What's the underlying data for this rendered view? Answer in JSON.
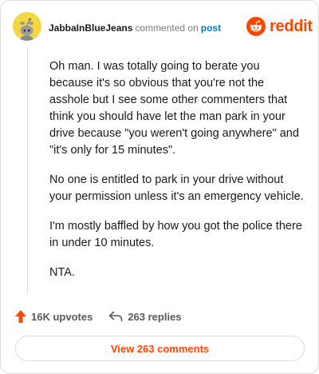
{
  "header": {
    "username": "JabbaInBlueJeans",
    "action": "commented on",
    "post_link": "post"
  },
  "brand": {
    "wordmark": "reddit",
    "icon": "reddit-snoo-icon",
    "color": "#ff4500"
  },
  "avatar": {
    "icon": "snoo-avatar-icon",
    "background": "#f3d743"
  },
  "comment": {
    "paragraphs": [
      "Oh man. I was totally going to berate you because it's so obvious that you're not the asshole but I see some other commenters that think you should have let the man park in your drive because \"you weren't going anywhere\" and \"it's only for 15 minutes\".",
      "No one is entitled to park in your drive without your permission unless it's an emergency vehicle.",
      "I'm mostly baffled by how you got the police there in under 10 minutes.",
      "NTA."
    ]
  },
  "stats": {
    "upvotes": "16K upvotes",
    "upvote_icon": "upvote-arrow-icon",
    "replies": "263 replies",
    "reply_icon": "reply-arrow-icon"
  },
  "view_comments": {
    "label": "View 263 comments"
  },
  "colors": {
    "accent": "#ff4500",
    "link": "#0079d3",
    "muted": "#787c7e",
    "text": "#1a1a1b"
  }
}
